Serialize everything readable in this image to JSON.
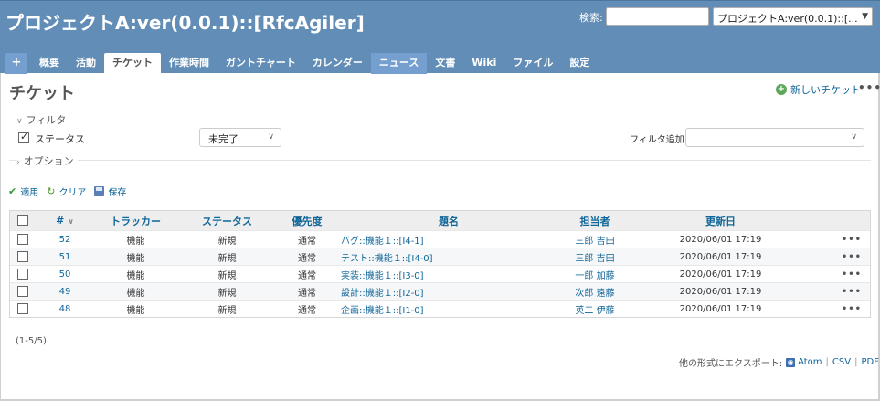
{
  "header": {
    "title": "プロジェクトA:ver(0.0.1)::[RfcAgiler]",
    "search_label": "検索:",
    "search_value": "",
    "project_select": "プロジェクトA:ver(0.0.1)::[..."
  },
  "tabs": [
    {
      "label": "+"
    },
    {
      "label": "概要"
    },
    {
      "label": "活動"
    },
    {
      "label": "チケット"
    },
    {
      "label": "作業時間"
    },
    {
      "label": "ガントチャート"
    },
    {
      "label": "カレンダー"
    },
    {
      "label": "ニュース"
    },
    {
      "label": "文書"
    },
    {
      "label": "Wiki"
    },
    {
      "label": "ファイル"
    },
    {
      "label": "設定"
    }
  ],
  "page": {
    "title": "チケット",
    "new_issue": "新しいチケット",
    "more": "•••"
  },
  "filters": {
    "legend": "フィルタ",
    "status_label": "ステータス",
    "status_value": "未完了",
    "add_filter_label": "フィルタ追加",
    "add_filter_value": "",
    "options_legend": "オプション"
  },
  "actions": {
    "apply": "適用",
    "clear": "クリア",
    "save": "保存"
  },
  "table": {
    "headers": {
      "id": "#",
      "tracker": "トラッカー",
      "status": "ステータス",
      "priority": "優先度",
      "subject": "題名",
      "assignee": "担当者",
      "updated": "更新日"
    },
    "rows": [
      {
        "id": "52",
        "tracker": "機能",
        "status": "新規",
        "priority": "通常",
        "subject": "バグ::機能１::[I4-1]",
        "assignee": "三郎 吉田",
        "updated": "2020/06/01 17:19"
      },
      {
        "id": "51",
        "tracker": "機能",
        "status": "新規",
        "priority": "通常",
        "subject": "テスト::機能１::[I4-0]",
        "assignee": "三郎 吉田",
        "updated": "2020/06/01 17:19"
      },
      {
        "id": "50",
        "tracker": "機能",
        "status": "新規",
        "priority": "通常",
        "subject": "実装::機能１::[I3-0]",
        "assignee": "一郎 加藤",
        "updated": "2020/06/01 17:19"
      },
      {
        "id": "49",
        "tracker": "機能",
        "status": "新規",
        "priority": "通常",
        "subject": "設計::機能１::[I2-0]",
        "assignee": "次郎 遠藤",
        "updated": "2020/06/01 17:19"
      },
      {
        "id": "48",
        "tracker": "機能",
        "status": "新規",
        "priority": "通常",
        "subject": "企画::機能１::[I1-0]",
        "assignee": "英二 伊藤",
        "updated": "2020/06/01 17:19"
      }
    ],
    "row_more": "•••"
  },
  "pager": "(1-5/5)",
  "export": {
    "label": "他の形式にエクスポート:",
    "atom": "Atom",
    "csv": "CSV",
    "pdf": "PDF"
  }
}
